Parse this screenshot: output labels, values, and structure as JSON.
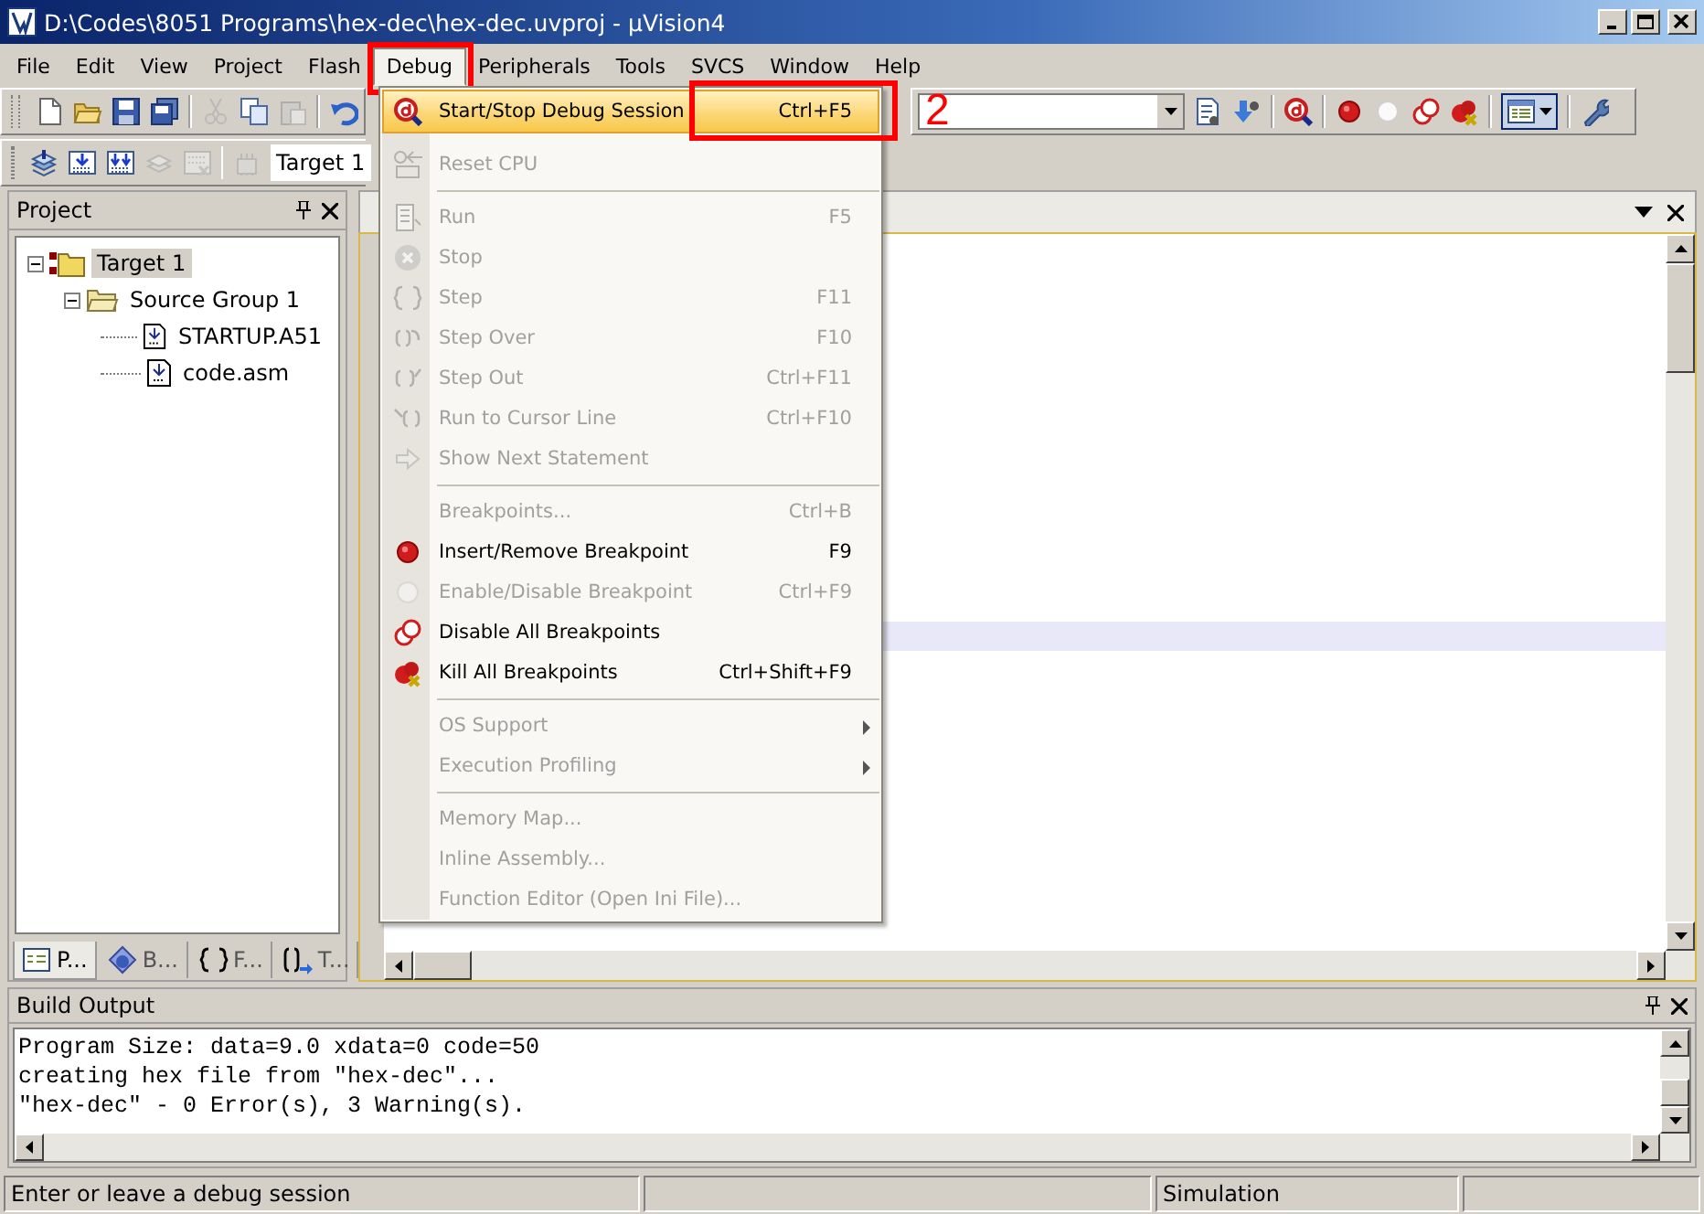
{
  "window": {
    "title": "D:\\Codes\\8051 Programs\\hex-dec\\hex-dec.uvproj - µVision4"
  },
  "menubar": [
    {
      "label": "File",
      "selected": false,
      "annotated": false
    },
    {
      "label": "Edit",
      "selected": false,
      "annotated": false
    },
    {
      "label": "View",
      "selected": false,
      "annotated": false
    },
    {
      "label": "Project",
      "selected": false,
      "annotated": false
    },
    {
      "label": "Flash",
      "selected": false,
      "annotated": false
    },
    {
      "label": "Debug",
      "selected": true,
      "annotated": true
    },
    {
      "label": "Peripherals",
      "selected": false,
      "annotated": false
    },
    {
      "label": "Tools",
      "selected": false,
      "annotated": false
    },
    {
      "label": "SVCS",
      "selected": false,
      "annotated": false
    },
    {
      "label": "Window",
      "selected": false,
      "annotated": false
    },
    {
      "label": "Help",
      "selected": false,
      "annotated": false
    }
  ],
  "toolbar": {
    "target_select": "Target 1"
  },
  "annotation": {
    "label": "2"
  },
  "debug_menu": {
    "items": [
      {
        "kind": "item",
        "label": "Start/Stop Debug Session",
        "shortcut": "Ctrl+F5",
        "disabled": false,
        "selected": true,
        "submenu": false,
        "annotated": true
      },
      {
        "kind": "item",
        "label": "Reset CPU",
        "disabled": true,
        "selected": false,
        "submenu": false,
        "annotated": false
      },
      {
        "kind": "separator"
      },
      {
        "kind": "item",
        "label": "Run",
        "shortcut": "F5",
        "disabled": true,
        "selected": false,
        "submenu": false,
        "annotated": false
      },
      {
        "kind": "item",
        "label": "Stop",
        "disabled": true,
        "selected": false,
        "submenu": false,
        "annotated": false
      },
      {
        "kind": "item",
        "label": "Step",
        "shortcut": "F11",
        "disabled": true,
        "selected": false,
        "submenu": false,
        "annotated": false
      },
      {
        "kind": "item",
        "label": "Step Over",
        "shortcut": "F10",
        "disabled": true,
        "selected": false,
        "submenu": false,
        "annotated": false
      },
      {
        "kind": "item",
        "label": "Step Out",
        "shortcut": "Ctrl+F11",
        "disabled": true,
        "selected": false,
        "submenu": false,
        "annotated": false
      },
      {
        "kind": "item",
        "label": "Run to Cursor Line",
        "shortcut": "Ctrl+F10",
        "disabled": true,
        "selected": false,
        "submenu": false,
        "annotated": false
      },
      {
        "kind": "item",
        "label": "Show Next Statement",
        "disabled": true,
        "selected": false,
        "submenu": false,
        "annotated": false
      },
      {
        "kind": "separator"
      },
      {
        "kind": "item",
        "label": "Breakpoints...",
        "shortcut": "Ctrl+B",
        "disabled": true,
        "selected": false,
        "submenu": false,
        "annotated": false
      },
      {
        "kind": "item",
        "label": "Insert/Remove Breakpoint",
        "shortcut": "F9",
        "disabled": false,
        "selected": false,
        "submenu": false,
        "annotated": false
      },
      {
        "kind": "item",
        "label": "Enable/Disable Breakpoint",
        "shortcut": "Ctrl+F9",
        "disabled": true,
        "selected": false,
        "submenu": false,
        "annotated": false
      },
      {
        "kind": "item",
        "label": "Disable All Breakpoints",
        "disabled": false,
        "selected": false,
        "submenu": false,
        "annotated": false
      },
      {
        "kind": "item",
        "label": "Kill All Breakpoints",
        "shortcut": "Ctrl+Shift+F9",
        "disabled": false,
        "selected": false,
        "submenu": false,
        "annotated": false
      },
      {
        "kind": "separator"
      },
      {
        "kind": "item",
        "label": "OS Support",
        "disabled": true,
        "selected": false,
        "submenu": true,
        "annotated": false
      },
      {
        "kind": "item",
        "label": "Execution Profiling",
        "disabled": true,
        "selected": false,
        "submenu": true,
        "annotated": false
      },
      {
        "kind": "separator"
      },
      {
        "kind": "item",
        "label": "Memory Map...",
        "disabled": true,
        "selected": false,
        "submenu": false,
        "annotated": false
      },
      {
        "kind": "item",
        "label": "Inline Assembly...",
        "disabled": true,
        "selected": false,
        "submenu": false,
        "annotated": false
      },
      {
        "kind": "item",
        "label": "Function Editor (Open Ini File)...",
        "disabled": true,
        "selected": false,
        "submenu": false,
        "annotated": false
      }
    ]
  },
  "project_panel": {
    "title": "Project",
    "tree": [
      {
        "label": "Target 1",
        "selected": true,
        "expanded": true,
        "children": [
          {
            "label": "Source Group 1",
            "selected": false,
            "expanded": true,
            "children": [
              {
                "label": "STARTUP.A51",
                "selected": false
              },
              {
                "label": "code.asm",
                "selected": false
              }
            ]
          }
        ]
      }
    ],
    "tabs": [
      {
        "label": "P...",
        "selected": true
      },
      {
        "label": "B...",
        "selected": false
      },
      {
        "label": "F...",
        "selected": false
      },
      {
        "label": "T...",
        "selected": false
      }
    ]
  },
  "build_output": {
    "title": "Build Output",
    "lines": [
      "Program Size: data=9.0 xdata=0 code=50",
      "creating hex file from \"hex-dec\"...",
      "\"hex-dec\" - 0 Error(s), 3 Warning(s)."
    ]
  },
  "status_bar": {
    "message": "Enter or leave a debug session",
    "mode": "Simulation"
  }
}
